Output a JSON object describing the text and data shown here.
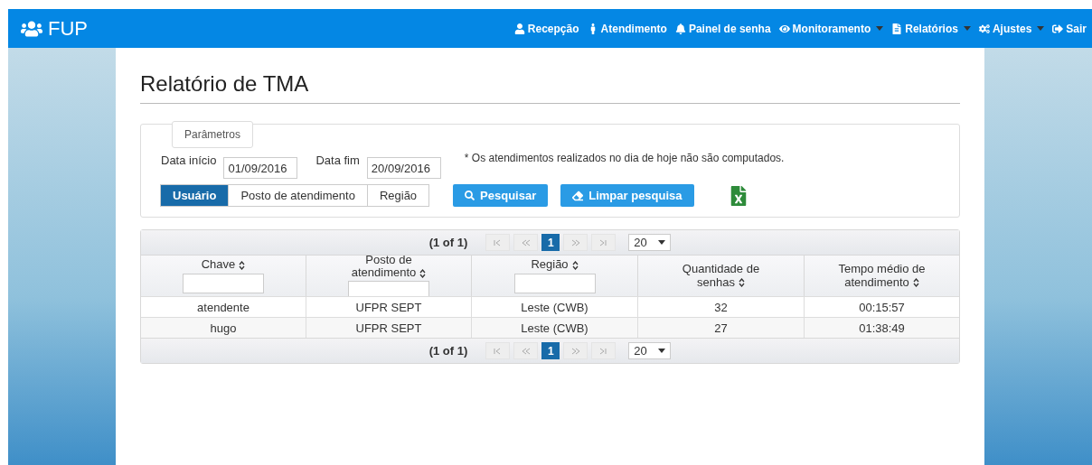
{
  "brand": "FUP",
  "nav": [
    {
      "label": "Recepção",
      "dropdown": false
    },
    {
      "label": "Atendimento",
      "dropdown": false
    },
    {
      "label": "Painel de senha",
      "dropdown": false
    },
    {
      "label": "Monitoramento",
      "dropdown": true
    },
    {
      "label": "Relatórios",
      "dropdown": true
    },
    {
      "label": "Ajustes",
      "dropdown": true
    },
    {
      "label": "Sair",
      "dropdown": false
    }
  ],
  "title": "Relatório de TMA",
  "parameters": {
    "legend": "Parâmetros",
    "start": {
      "label": "Data início",
      "value": "01/09/2016"
    },
    "end": {
      "label": "Data fim",
      "value": "20/09/2016"
    },
    "note": "* Os atendimentos realizados no dia de hoje não são computados.",
    "groups": [
      {
        "label": "Usuário",
        "selected": true
      },
      {
        "label": "Posto de atendimento",
        "selected": false
      },
      {
        "label": "Região",
        "selected": false
      }
    ],
    "search_button": "Pesquisar",
    "clear_button": "Limpar pesquisa"
  },
  "table": {
    "paginator_top": {
      "report": "(1 of 1)",
      "page": "1",
      "rows": "20"
    },
    "columns": [
      {
        "label": "Chave",
        "filter": true
      },
      {
        "label": "Posto de atendimento",
        "filter": true
      },
      {
        "label": "Região",
        "filter": true
      },
      {
        "label": "Quantidade de senhas",
        "filter": false
      },
      {
        "label": "Tempo médio de atendimento",
        "filter": false
      }
    ],
    "rows": [
      [
        "atendente",
        "UFPR SEPT",
        "Leste (CWB)",
        "32",
        "00:15:57"
      ],
      [
        "hugo",
        "UFPR SEPT",
        "Leste (CWB)",
        "27",
        "01:38:49"
      ]
    ],
    "paginator_bottom": {
      "report": "(1 of 1)",
      "page": "1",
      "rows": "20"
    }
  }
}
